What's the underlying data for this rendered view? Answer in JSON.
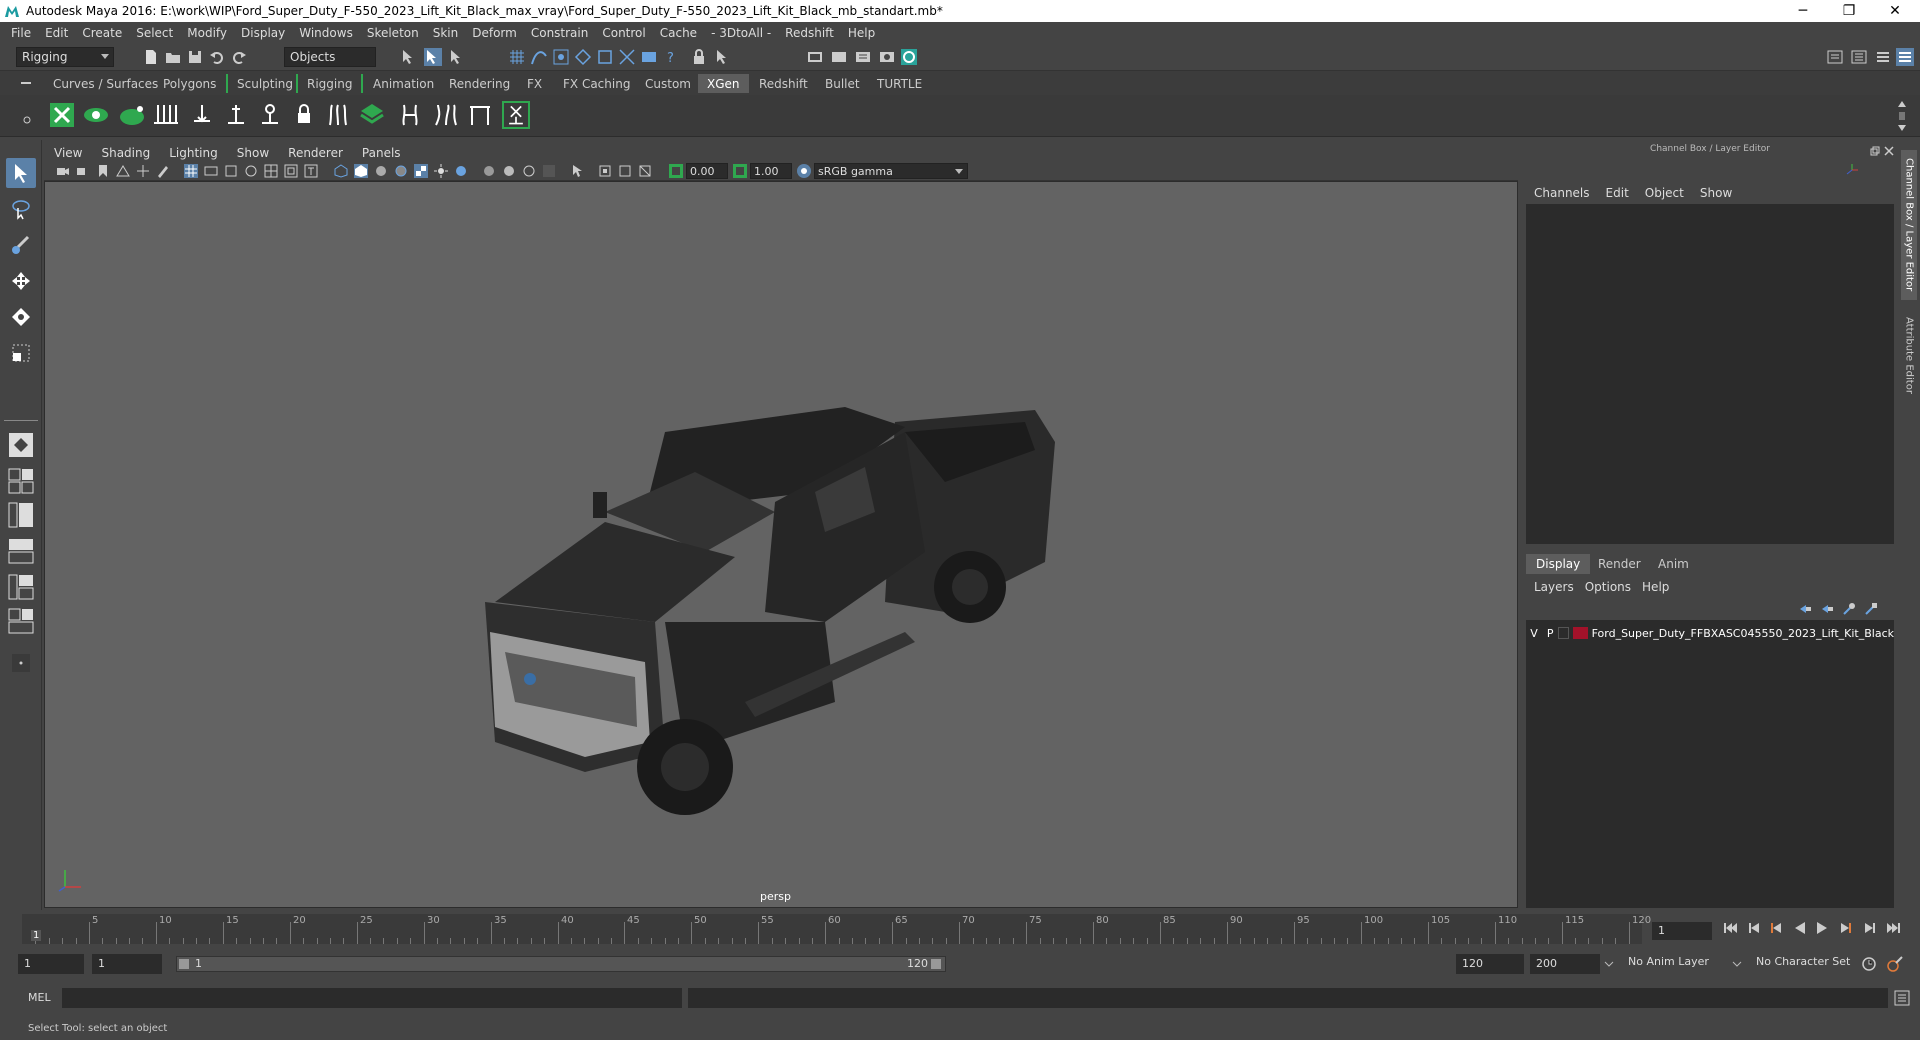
{
  "window": {
    "title": "Autodesk Maya 2016: E:\\work\\WIP\\Ford_Super_Duty_F-550_2023_Lift_Kit_Black_max_vray\\Ford_Super_Duty_F-550_2023_Lift_Kit_Black_mb_standart.mb*",
    "minimize": "─",
    "restore": "❐",
    "close": "✕"
  },
  "menubar": [
    "File",
    "Edit",
    "Create",
    "Select",
    "Modify",
    "Display",
    "Windows",
    "Skeleton",
    "Skin",
    "Deform",
    "Constrain",
    "Control",
    "Cache",
    "- 3DtoAll -",
    "Redshift",
    "Help"
  ],
  "statusline": {
    "menuset": "Rigging",
    "selection_mode": "Objects"
  },
  "shelf_tabs": [
    "Curves / Surfaces",
    "Polygons",
    "Sculpting",
    "Rigging",
    "Animation",
    "Rendering",
    "FX",
    "FX Caching",
    "Custom",
    "XGen",
    "Redshift",
    "Bullet",
    "TURTLE"
  ],
  "shelf_active": "XGen",
  "viewport": {
    "menus": [
      "View",
      "Shading",
      "Lighting",
      "Show",
      "Renderer",
      "Panels"
    ],
    "exposure": "0.00",
    "gamma": "1.00",
    "colorspace": "sRGB gamma",
    "camera": "persp"
  },
  "channel_box": {
    "title": "Channel Box / Layer Editor",
    "menus": [
      "Channels",
      "Edit",
      "Object",
      "Show"
    ],
    "layer_tabs": [
      "Display",
      "Render",
      "Anim"
    ],
    "active_layer_tab": "Display",
    "layer_menus": [
      "Layers",
      "Options",
      "Help"
    ],
    "layer": {
      "v": "V",
      "p": "P",
      "name": "Ford_Super_Duty_FFBXASC045550_2023_Lift_Kit_Black",
      "color": "#a3122a"
    }
  },
  "side_tabs": [
    "Channel Box / Layer Editor",
    "Attribute Editor"
  ],
  "timeline": {
    "ticks": [
      "5",
      "10",
      "15",
      "20",
      "25",
      "30",
      "35",
      "40",
      "45",
      "50",
      "55",
      "60",
      "65",
      "70",
      "75",
      "80",
      "85",
      "90",
      "95",
      "100",
      "105",
      "110",
      "115",
      "120"
    ],
    "current_frame_marker": "1",
    "current_frame": "1"
  },
  "range": {
    "start": "1",
    "playback_start": "1",
    "slider_start": "1",
    "slider_end": "120",
    "playback_end": "120",
    "end": "200",
    "anim_layer": "No Anim Layer",
    "character_set": "No Character Set"
  },
  "command": {
    "label": "MEL"
  },
  "help_line": "Select Tool: select an object",
  "colors": {
    "accent": "#5b81a8",
    "shelf_green": "#2fa84f",
    "ui_bg": "#444444",
    "viewport_bg": "#636363"
  }
}
